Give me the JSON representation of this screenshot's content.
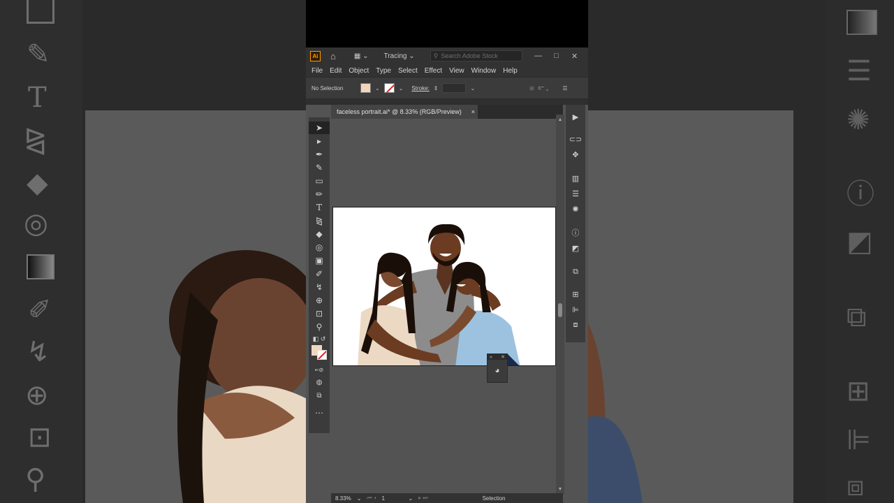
{
  "app": {
    "logo": "Ai",
    "workspace": "Tracing",
    "search_placeholder": "Search Adobe Stock"
  },
  "menu": [
    "File",
    "Edit",
    "Object",
    "Type",
    "Select",
    "Effect",
    "View",
    "Window",
    "Help"
  ],
  "control_bar": {
    "selection_label": "No Selection",
    "stroke_label": "Stroke:"
  },
  "document": {
    "tab_title": "faceless portrait.ai* @ 8.33% (RGB/Preview)",
    "tab_close": "×"
  },
  "status": {
    "zoom": "8.33%",
    "artboard_number": "1",
    "current_tool": "Selection"
  },
  "colors": {
    "fill": "#f2d5bd",
    "accent_logo": "#ff9a00",
    "stroke_none_slash": "#e02020"
  },
  "icons": {
    "tools": [
      "selection-arrow-icon",
      "direct-selection-icon",
      "pen-icon",
      "curvature-icon",
      "rectangle-icon",
      "pencil-icon",
      "type-icon",
      "reflect-icon",
      "eraser-icon",
      "lasso-icon",
      "gradient-icon",
      "eyedropper-icon",
      "blend-icon",
      "shape-builder-icon",
      "artboard-icon",
      "zoom-icon"
    ],
    "panels": [
      "play-icon",
      "link-icon",
      "puppet-warp-icon",
      "gradient-panel-icon",
      "stroke-panel-icon",
      "appearance-icon",
      "info-icon",
      "image-trace-icon",
      "transform-icon",
      "pathfinder-icon",
      "align-icon",
      "layers-icon"
    ]
  }
}
